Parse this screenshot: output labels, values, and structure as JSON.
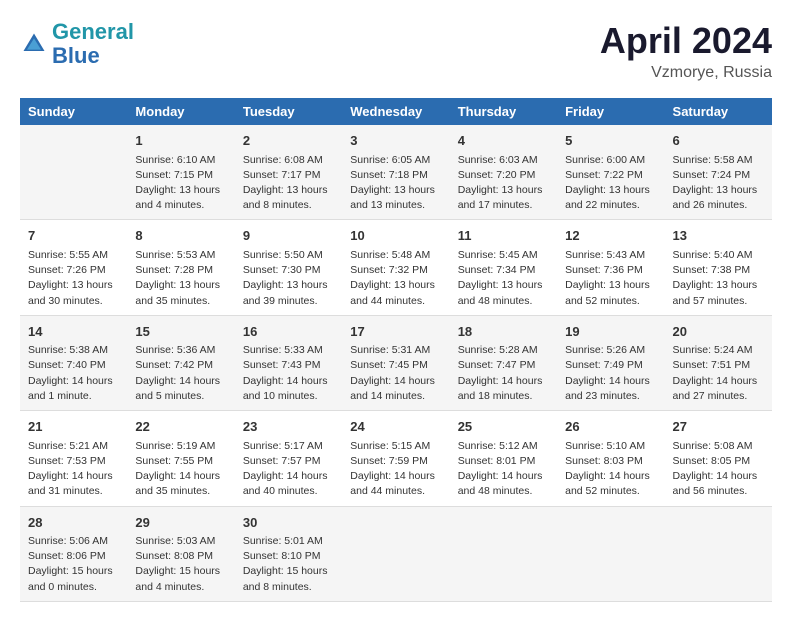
{
  "header": {
    "logo_line1": "General",
    "logo_line2": "Blue",
    "month_year": "April 2024",
    "location": "Vzmorye, Russia"
  },
  "days_of_week": [
    "Sunday",
    "Monday",
    "Tuesday",
    "Wednesday",
    "Thursday",
    "Friday",
    "Saturday"
  ],
  "weeks": [
    [
      {
        "day": "",
        "info": ""
      },
      {
        "day": "1",
        "info": "Sunrise: 6:10 AM\nSunset: 7:15 PM\nDaylight: 13 hours\nand 4 minutes."
      },
      {
        "day": "2",
        "info": "Sunrise: 6:08 AM\nSunset: 7:17 PM\nDaylight: 13 hours\nand 8 minutes."
      },
      {
        "day": "3",
        "info": "Sunrise: 6:05 AM\nSunset: 7:18 PM\nDaylight: 13 hours\nand 13 minutes."
      },
      {
        "day": "4",
        "info": "Sunrise: 6:03 AM\nSunset: 7:20 PM\nDaylight: 13 hours\nand 17 minutes."
      },
      {
        "day": "5",
        "info": "Sunrise: 6:00 AM\nSunset: 7:22 PM\nDaylight: 13 hours\nand 22 minutes."
      },
      {
        "day": "6",
        "info": "Sunrise: 5:58 AM\nSunset: 7:24 PM\nDaylight: 13 hours\nand 26 minutes."
      }
    ],
    [
      {
        "day": "7",
        "info": "Sunrise: 5:55 AM\nSunset: 7:26 PM\nDaylight: 13 hours\nand 30 minutes."
      },
      {
        "day": "8",
        "info": "Sunrise: 5:53 AM\nSunset: 7:28 PM\nDaylight: 13 hours\nand 35 minutes."
      },
      {
        "day": "9",
        "info": "Sunrise: 5:50 AM\nSunset: 7:30 PM\nDaylight: 13 hours\nand 39 minutes."
      },
      {
        "day": "10",
        "info": "Sunrise: 5:48 AM\nSunset: 7:32 PM\nDaylight: 13 hours\nand 44 minutes."
      },
      {
        "day": "11",
        "info": "Sunrise: 5:45 AM\nSunset: 7:34 PM\nDaylight: 13 hours\nand 48 minutes."
      },
      {
        "day": "12",
        "info": "Sunrise: 5:43 AM\nSunset: 7:36 PM\nDaylight: 13 hours\nand 52 minutes."
      },
      {
        "day": "13",
        "info": "Sunrise: 5:40 AM\nSunset: 7:38 PM\nDaylight: 13 hours\nand 57 minutes."
      }
    ],
    [
      {
        "day": "14",
        "info": "Sunrise: 5:38 AM\nSunset: 7:40 PM\nDaylight: 14 hours\nand 1 minute."
      },
      {
        "day": "15",
        "info": "Sunrise: 5:36 AM\nSunset: 7:42 PM\nDaylight: 14 hours\nand 5 minutes."
      },
      {
        "day": "16",
        "info": "Sunrise: 5:33 AM\nSunset: 7:43 PM\nDaylight: 14 hours\nand 10 minutes."
      },
      {
        "day": "17",
        "info": "Sunrise: 5:31 AM\nSunset: 7:45 PM\nDaylight: 14 hours\nand 14 minutes."
      },
      {
        "day": "18",
        "info": "Sunrise: 5:28 AM\nSunset: 7:47 PM\nDaylight: 14 hours\nand 18 minutes."
      },
      {
        "day": "19",
        "info": "Sunrise: 5:26 AM\nSunset: 7:49 PM\nDaylight: 14 hours\nand 23 minutes."
      },
      {
        "day": "20",
        "info": "Sunrise: 5:24 AM\nSunset: 7:51 PM\nDaylight: 14 hours\nand 27 minutes."
      }
    ],
    [
      {
        "day": "21",
        "info": "Sunrise: 5:21 AM\nSunset: 7:53 PM\nDaylight: 14 hours\nand 31 minutes."
      },
      {
        "day": "22",
        "info": "Sunrise: 5:19 AM\nSunset: 7:55 PM\nDaylight: 14 hours\nand 35 minutes."
      },
      {
        "day": "23",
        "info": "Sunrise: 5:17 AM\nSunset: 7:57 PM\nDaylight: 14 hours\nand 40 minutes."
      },
      {
        "day": "24",
        "info": "Sunrise: 5:15 AM\nSunset: 7:59 PM\nDaylight: 14 hours\nand 44 minutes."
      },
      {
        "day": "25",
        "info": "Sunrise: 5:12 AM\nSunset: 8:01 PM\nDaylight: 14 hours\nand 48 minutes."
      },
      {
        "day": "26",
        "info": "Sunrise: 5:10 AM\nSunset: 8:03 PM\nDaylight: 14 hours\nand 52 minutes."
      },
      {
        "day": "27",
        "info": "Sunrise: 5:08 AM\nSunset: 8:05 PM\nDaylight: 14 hours\nand 56 minutes."
      }
    ],
    [
      {
        "day": "28",
        "info": "Sunrise: 5:06 AM\nSunset: 8:06 PM\nDaylight: 15 hours\nand 0 minutes."
      },
      {
        "day": "29",
        "info": "Sunrise: 5:03 AM\nSunset: 8:08 PM\nDaylight: 15 hours\nand 4 minutes."
      },
      {
        "day": "30",
        "info": "Sunrise: 5:01 AM\nSunset: 8:10 PM\nDaylight: 15 hours\nand 8 minutes."
      },
      {
        "day": "",
        "info": ""
      },
      {
        "day": "",
        "info": ""
      },
      {
        "day": "",
        "info": ""
      },
      {
        "day": "",
        "info": ""
      }
    ]
  ]
}
